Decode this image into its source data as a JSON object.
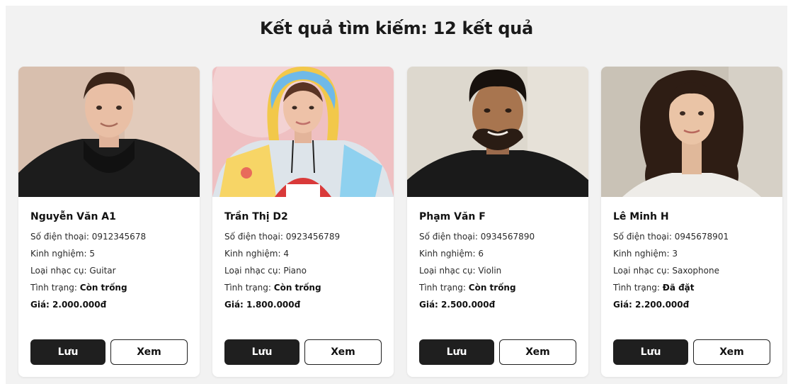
{
  "header": {
    "title": "Kết quả tìm kiếm: 12 kết quả"
  },
  "labels": {
    "phone": "Số điện thoại: ",
    "experience": "Kinh nghiệm: ",
    "instrument": "Loại nhạc cụ: ",
    "status": "Tình trạng: ",
    "price": "Giá: ",
    "save": "Lưu",
    "view": "Xem"
  },
  "results": [
    {
      "name": "Nguyễn Văn A1",
      "phone": "0912345678",
      "experience": "5",
      "instrument": "Guitar",
      "status": "Còn trống",
      "price": "2.000.000đ",
      "photo": "young-man-black-hoodie-portrait"
    },
    {
      "name": "Trần Thị D2",
      "phone": "0923456789",
      "experience": "4",
      "instrument": "Piano",
      "status": "Còn trống",
      "price": "1.800.000đ",
      "photo": "young-woman-colorful-hoodie-portrait"
    },
    {
      "name": "Phạm Văn F",
      "phone": "0934567890",
      "experience": "6",
      "instrument": "Violin",
      "status": "Còn trống",
      "price": "2.500.000đ",
      "photo": "young-man-beard-black-tshirt-portrait"
    },
    {
      "name": "Lê Minh H",
      "phone": "0945678901",
      "experience": "3",
      "instrument": "Saxophone",
      "status": "Đã đặt",
      "price": "2.200.000đ",
      "photo": "young-woman-wavy-hair-portrait"
    }
  ]
}
